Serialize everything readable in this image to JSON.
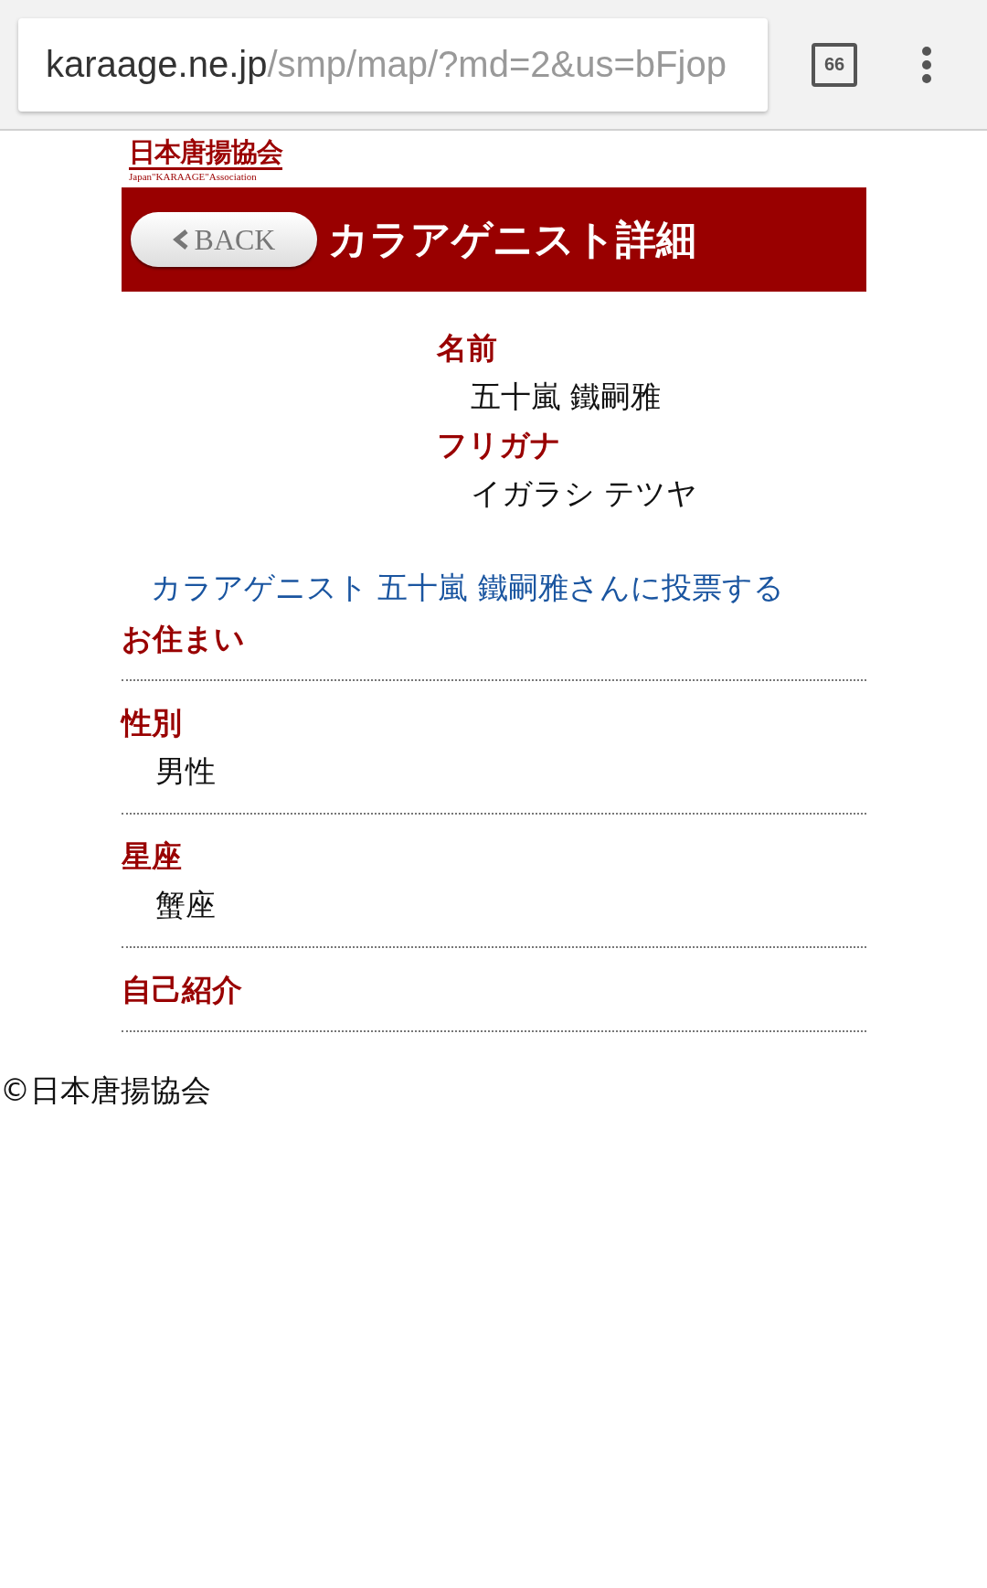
{
  "browser": {
    "url_host": "karaage.ne.jp",
    "url_path": "/smp/map/?md=2&us=bFjop",
    "tab_count": "66"
  },
  "logo": {
    "title": "日本唐揚協会",
    "subtitle": "Japan\"KARAAGE\"Association"
  },
  "header": {
    "back_label": "BACK",
    "title": "カラアゲニスト詳細"
  },
  "profile": [
    {
      "label": "名前",
      "value": "五十嵐 鐵嗣雅"
    },
    {
      "label": "フリガナ",
      "value": "イガラシ テツヤ"
    }
  ],
  "vote_link": "カラアゲニスト 五十嵐 鐵嗣雅さんに投票する",
  "sections": [
    {
      "label": "お住まい"
    },
    {
      "label": "性別",
      "value": "男性"
    },
    {
      "label": "星座",
      "value": "蟹座"
    },
    {
      "label": "自己紹介"
    }
  ],
  "footer": "©日本唐揚協会"
}
